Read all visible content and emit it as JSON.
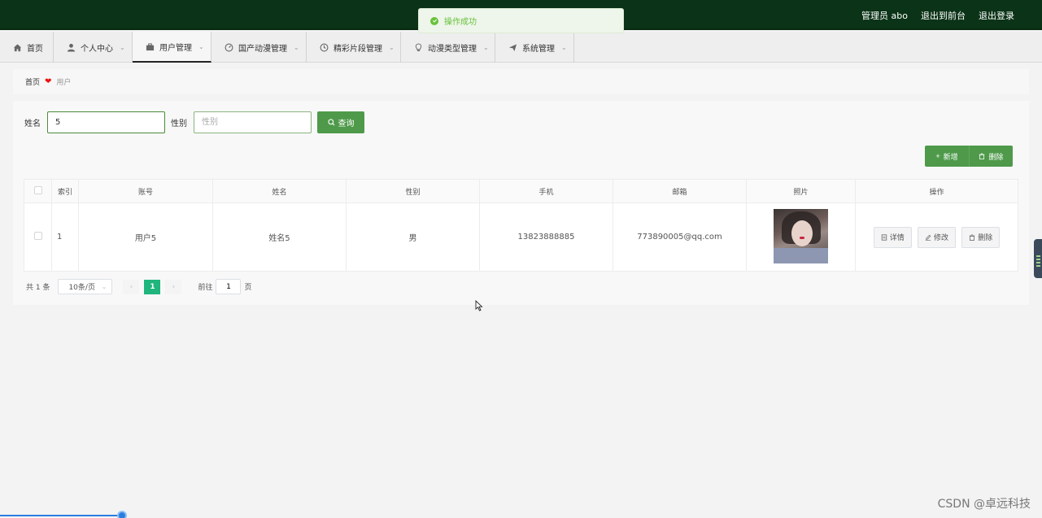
{
  "header": {
    "admin_label": "管理员 abo",
    "front_link": "退出到前台",
    "logout_link": "退出登录"
  },
  "toast": {
    "message": "操作成功"
  },
  "nav": {
    "items": [
      {
        "label": "首页",
        "icon": "home-icon"
      },
      {
        "label": "个人中心",
        "icon": "user-icon"
      },
      {
        "label": "用户管理",
        "icon": "briefcase-icon"
      },
      {
        "label": "国产动漫管理",
        "icon": "gauge-icon"
      },
      {
        "label": "精彩片段管理",
        "icon": "clock-icon"
      },
      {
        "label": "动漫类型管理",
        "icon": "bulb-icon"
      },
      {
        "label": "系统管理",
        "icon": "send-icon"
      }
    ]
  },
  "breadcrumb": {
    "home": "首页",
    "current": "用户"
  },
  "search": {
    "name_label": "姓名",
    "name_value": "5",
    "gender_label": "性别",
    "gender_placeholder": "性别",
    "query_button": "查询"
  },
  "actions": {
    "add": "新增",
    "delete": "删除"
  },
  "table": {
    "headers": [
      "索引",
      "账号",
      "姓名",
      "性别",
      "手机",
      "邮箱",
      "照片",
      "操作"
    ],
    "rows": [
      {
        "index": "1",
        "account": "用户5",
        "name": "姓名5",
        "gender": "男",
        "phone": "13823888885",
        "email": "773890005@qq.com"
      }
    ],
    "row_buttons": {
      "detail": "详情",
      "edit": "修改",
      "delete": "删除"
    }
  },
  "pager": {
    "total": "共 1 条",
    "page_size": "10条/页",
    "current_page": "1",
    "goto_label": "前往",
    "goto_value": "1",
    "page_unit": "页"
  },
  "watermark": "CSDN @卓远科技",
  "colors": {
    "header_bg": "#0b3317",
    "primary": "#4e9a4a",
    "pager_active": "#1fb57c"
  }
}
